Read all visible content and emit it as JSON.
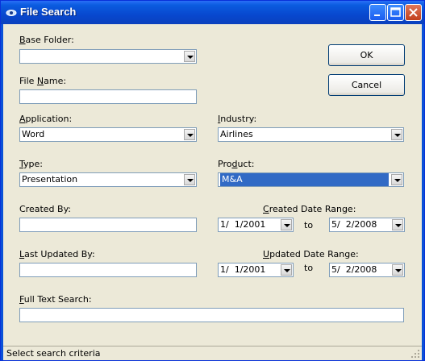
{
  "window": {
    "title": "File Search"
  },
  "buttons": {
    "ok": "OK",
    "cancel": "Cancel"
  },
  "base_folder": {
    "label_key": "B",
    "label_rest": "ase Folder:",
    "value": ""
  },
  "file_name": {
    "label_pre": "File ",
    "label_key": "N",
    "label_rest": "ame:",
    "value": ""
  },
  "application": {
    "label_key": "A",
    "label_rest": "pplication:",
    "value": "Word"
  },
  "industry": {
    "label_key": "I",
    "label_rest": "ndustry:",
    "value": "Airlines"
  },
  "type": {
    "label_key": "T",
    "label_rest": "ype:",
    "value": "Presentation"
  },
  "product": {
    "label_pre": "Pro",
    "label_key": "d",
    "label_rest": "uct:",
    "value": "M&A"
  },
  "created_by": {
    "label": "Created By:",
    "value": ""
  },
  "created_range": {
    "label_key": "C",
    "label_rest": "reated Date Range:",
    "from": "1/  1/2001",
    "to_label": "to",
    "to": "5/  2/2008"
  },
  "last_updated_by": {
    "label_key": "L",
    "label_rest": "ast Updated By:",
    "value": ""
  },
  "updated_range": {
    "label_key": "U",
    "label_rest": "pdated Date Range:",
    "from": "1/  1/2001",
    "to_label": "to",
    "to": "5/  2/2008"
  },
  "full_text": {
    "label_key": "F",
    "label_rest": "ull Text Search:",
    "value": ""
  },
  "status": {
    "text": "Select search criteria"
  },
  "colors": {
    "titlebar": "#0a51d7",
    "face": "#ece9d8",
    "selection": "#316ac5"
  }
}
